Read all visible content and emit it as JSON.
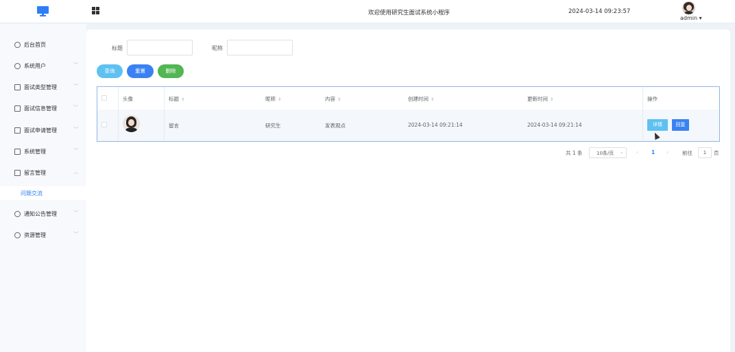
{
  "header": {
    "welcome": "欢迎使用研究生面试系统小程序",
    "datetime": "2024-03-14 09:23:57",
    "user": "admin ▾"
  },
  "sidebar": {
    "items": [
      {
        "label": "后台首页",
        "icon": "clock-icon"
      },
      {
        "label": "系统用户",
        "icon": "user-icon",
        "arrow": "﹀"
      },
      {
        "label": "面试类型管理",
        "icon": "doc-icon",
        "arrow": "﹀"
      },
      {
        "label": "面试信息管理",
        "icon": "doc-icon",
        "arrow": "﹀"
      },
      {
        "label": "面试申请管理",
        "icon": "doc-icon",
        "arrow": "﹀"
      },
      {
        "label": "系统管理",
        "icon": "folder-icon",
        "arrow": "﹀"
      },
      {
        "label": "留言管理",
        "icon": "folder-icon",
        "arrow": "︿"
      },
      {
        "label": "问题交流",
        "sub": true
      },
      {
        "label": "通知公告管理",
        "icon": "sun-icon",
        "arrow": "﹀"
      },
      {
        "label": "资源管理",
        "icon": "globe-icon",
        "arrow": "﹀"
      }
    ]
  },
  "search": {
    "title_label": "标题",
    "nickname_label": "昵称",
    "title_value": "",
    "nickname_value": ""
  },
  "buttons": {
    "query": "查询",
    "reset": "重置",
    "delete": "删除"
  },
  "table": {
    "headers": {
      "avatar": "头像",
      "title": "标题",
      "nickname": "昵称",
      "content": "内容",
      "created": "创建时间",
      "updated": "更新时间",
      "actions": "操作"
    },
    "sort_glyph": "⇕",
    "rows": [
      {
        "title": "留言",
        "nickname": "研究生",
        "content": "发表观点",
        "created": "2024-03-14 09:21:14",
        "updated": "2024-03-14 09:21:14",
        "detail_label": "详情",
        "reply_label": "回复"
      }
    ]
  },
  "pagination": {
    "total": "共 1 条",
    "page_size": "10条/页",
    "prev": "‹",
    "current": "1",
    "next": "›",
    "goto_label": "前往",
    "goto_value": "1",
    "page_unit": "页"
  }
}
